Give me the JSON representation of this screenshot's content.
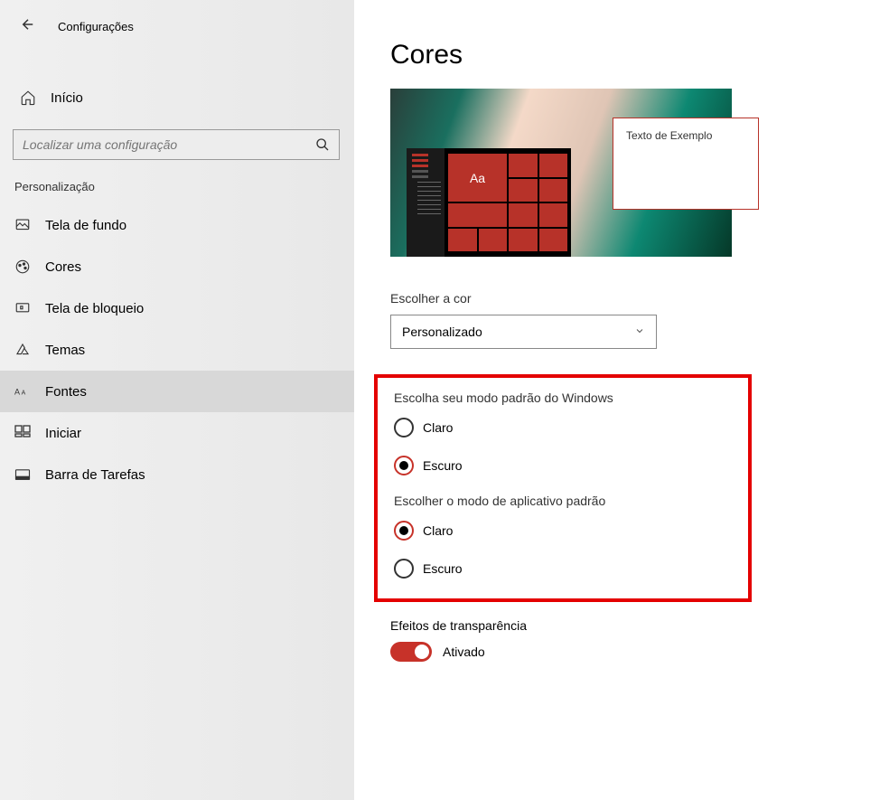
{
  "header": {
    "title": "Configurações"
  },
  "home": {
    "label": "Início"
  },
  "search": {
    "placeholder": "Localizar uma configuração"
  },
  "section": {
    "label": "Personalização"
  },
  "nav": {
    "items": [
      {
        "label": "Tela de fundo"
      },
      {
        "label": "Cores"
      },
      {
        "label": "Tela de bloqueio"
      },
      {
        "label": "Temas"
      },
      {
        "label": "Fontes"
      },
      {
        "label": "Iniciar"
      },
      {
        "label": "Barra de Tarefas"
      }
    ]
  },
  "main": {
    "title": "Cores",
    "preview_text": "Texto de Exemplo",
    "tile_label": "Aa",
    "color_label": "Escolher a cor",
    "color_value": "Personalizado",
    "windows_mode_label": "Escolha seu modo padrão do Windows",
    "app_mode_label": "Escolher o modo de aplicativo padrão",
    "options": {
      "light": "Claro",
      "dark": "Escuro"
    },
    "transparency_label": "Efeitos de transparência",
    "transparency_value": "Ativado"
  }
}
